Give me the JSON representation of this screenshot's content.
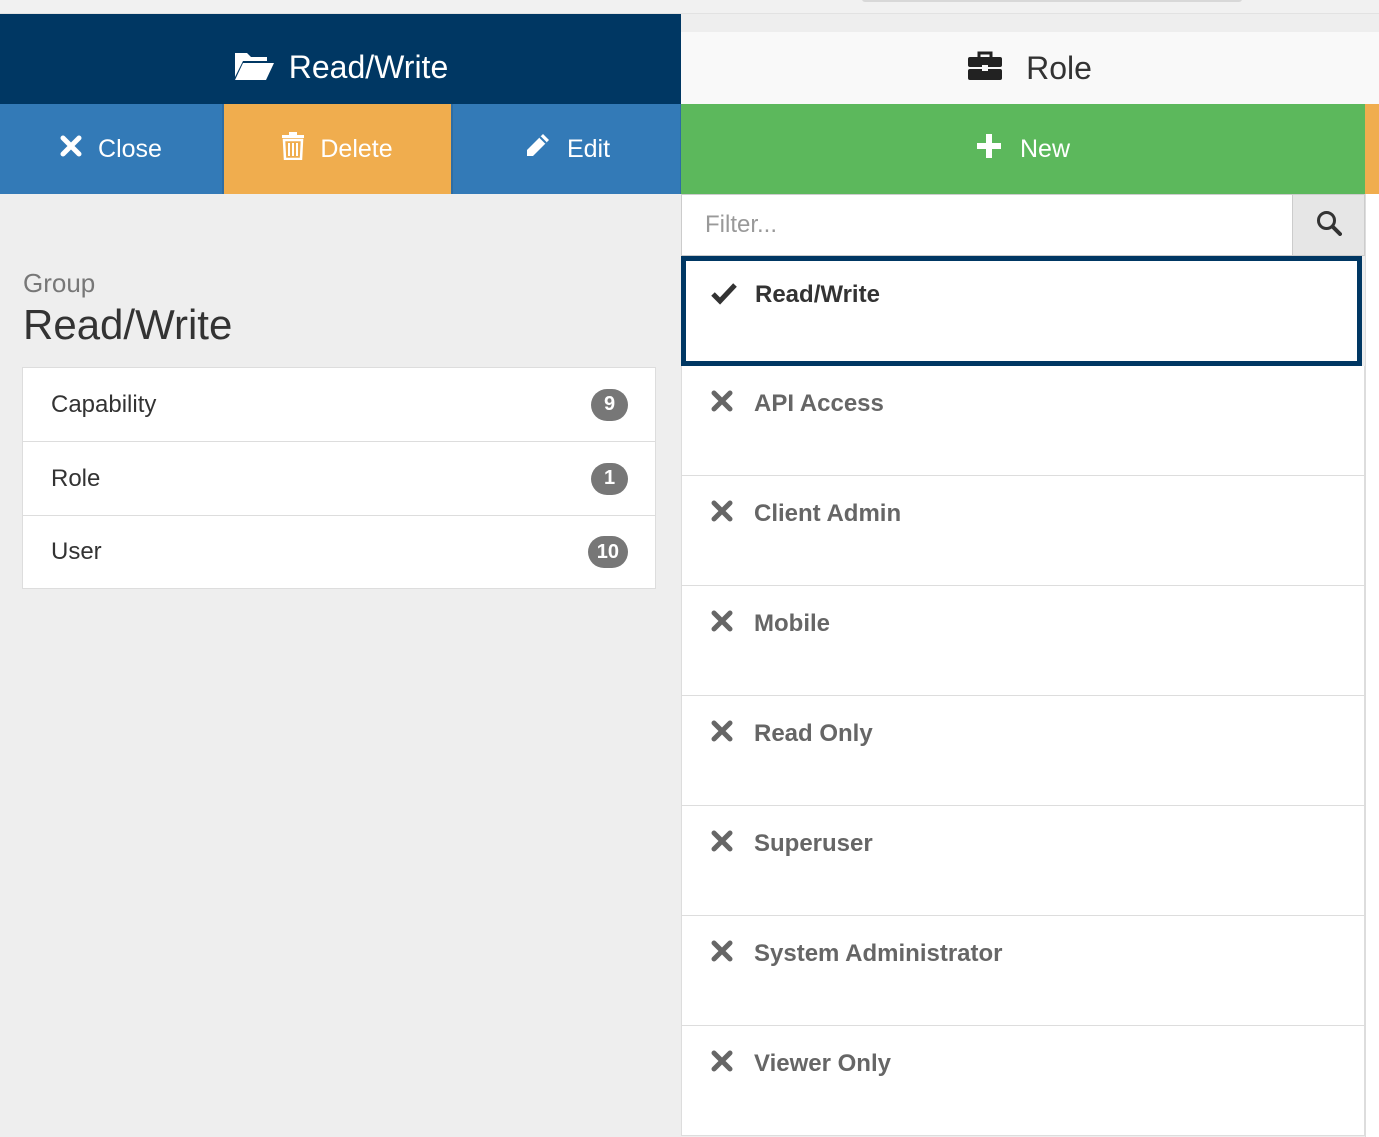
{
  "left": {
    "header": {
      "title": "Read/Write",
      "icon": "folder-open-icon"
    },
    "toolbar": {
      "close_label": "Close",
      "delete_label": "Delete",
      "edit_label": "Edit"
    },
    "group_label": "Group",
    "group_name": "Read/Write",
    "associations": [
      {
        "label": "Capability",
        "count": "9"
      },
      {
        "label": "Role",
        "count": "1"
      },
      {
        "label": "User",
        "count": "10"
      }
    ]
  },
  "right": {
    "header": {
      "title": "Role",
      "icon": "briefcase-icon"
    },
    "new_label": "New",
    "filter": {
      "placeholder": "Filter..."
    },
    "roles": [
      {
        "name": "Read/Write",
        "state": "checked"
      },
      {
        "name": "API Access",
        "state": "unchecked"
      },
      {
        "name": "Client Admin",
        "state": "unchecked"
      },
      {
        "name": "Mobile",
        "state": "unchecked"
      },
      {
        "name": "Read Only",
        "state": "unchecked"
      },
      {
        "name": "Superuser",
        "state": "unchecked"
      },
      {
        "name": "System Administrator",
        "state": "unchecked"
      },
      {
        "name": "Viewer Only",
        "state": "unchecked"
      }
    ]
  },
  "colors": {
    "navy": "#003763",
    "primary": "#337ab7",
    "warning": "#f0ad4e",
    "success": "#5cb85c",
    "badge": "#777777"
  }
}
